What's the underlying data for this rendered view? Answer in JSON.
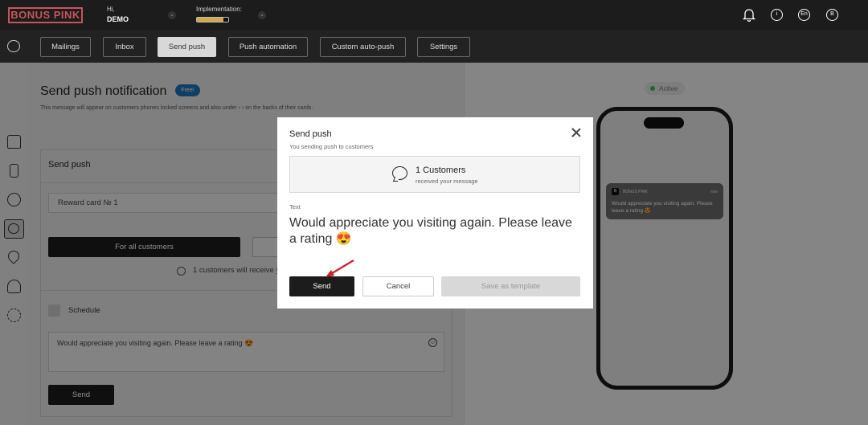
{
  "header": {
    "logo": "BONUS PINK",
    "greeting": "Hi,",
    "user_name": "DEMO",
    "implementation_label": "Implementation:",
    "implementation_progress": 0.85,
    "icons": [
      "bell-icon",
      "info-icon",
      "language-icon",
      "avatar-icon"
    ],
    "language": "En",
    "avatar_letter": "B"
  },
  "nav": {
    "tabs": [
      {
        "label": "Mailings"
      },
      {
        "label": "Inbox"
      },
      {
        "label": "Send push",
        "active": true
      },
      {
        "label": "Push automation"
      },
      {
        "label": "Custom auto-push"
      },
      {
        "label": "Settings"
      }
    ]
  },
  "sidebar": {
    "icons": [
      "chat-icon",
      "home-icon",
      "card-icon",
      "users-icon",
      "messages-icon",
      "location-icon",
      "profile-icon",
      "settings-icon"
    ]
  },
  "main": {
    "title": "Send push notification",
    "free_badge": "Free!",
    "subtitle": "This message will appear on customers phones locked screens and also under ‹ › on the backs of their cards.",
    "card_title": "Send push",
    "card_select": "Reward card № 1",
    "btn_all_customers": "For all customers",
    "receive_text": "1 customers will receive yo",
    "schedule_label": "Schedule",
    "message_text": "Would appreciate you visiting again. Please leave a rating 😍",
    "send_button": "Send"
  },
  "preview": {
    "status": "Active",
    "status_color": "#3dbb5a",
    "notification": {
      "logo_letter": "B",
      "app_name": "BONUS PINK",
      "time": "now",
      "text": "Would appreciate you visiting again. Please leave a rating 😍"
    }
  },
  "modal": {
    "title": "Send push",
    "subtitle": "You sending push to customers",
    "count": "1 Customers",
    "count_sub": "received your message",
    "text_label": "Text",
    "text": "Would appreciate you visiting again. Please leave a rating 😍",
    "send_button": "Send",
    "cancel_button": "Cancel",
    "template_button": "Save as template"
  }
}
